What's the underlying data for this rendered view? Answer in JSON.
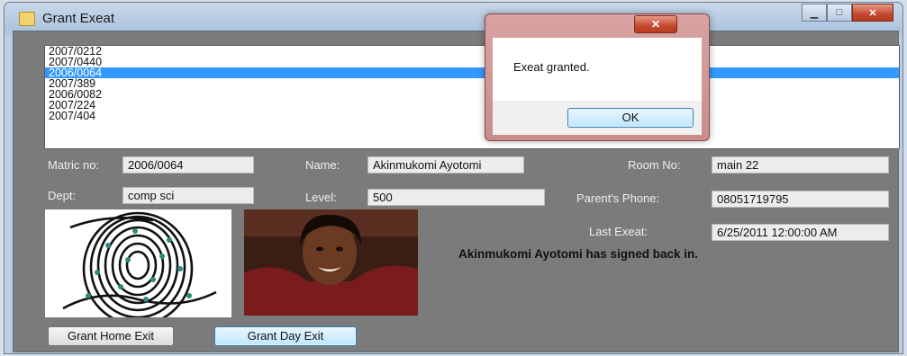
{
  "window": {
    "title": "Grant Exeat",
    "controls": {
      "minimize": "▁",
      "maximize": "□",
      "close": "✕"
    }
  },
  "list": {
    "items": [
      "2007/0212",
      "2007/0440",
      "2006/0064",
      "2007/389",
      "2006/0082",
      "2007/224",
      "2007/404"
    ],
    "selected": "2006/0064"
  },
  "fields": {
    "matric_label": "Matric no:",
    "matric_value": "2006/0064",
    "name_label": "Name:",
    "name_value": "Akinmukomi Ayotomi",
    "room_label": "Room No:",
    "room_value": "main 22",
    "dept_label": "Dept:",
    "dept_value": "comp sci",
    "level_label": "Level:",
    "level_value": "500",
    "phone_label": "Parent's Phone:",
    "phone_value": "08051719795",
    "last_exeat_label": "Last Exeat:",
    "last_exeat_value": "6/25/2011 12:00:00 AM"
  },
  "status": "Akinmukomi Ayotomi has signed back in.",
  "buttons": {
    "home_exit": "Grant Home Exit",
    "day_exit": "Grant Day Exit"
  },
  "dialog": {
    "message": "Exeat granted.",
    "ok": "OK",
    "close": "✕"
  },
  "colors": {
    "selection": "#3399ff",
    "client_bg": "#7b7b7b"
  }
}
